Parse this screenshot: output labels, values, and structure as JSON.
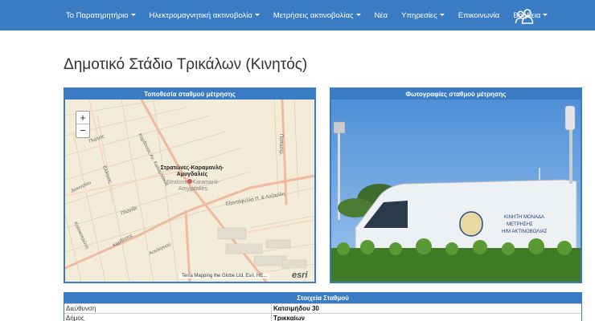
{
  "nav": {
    "items": [
      {
        "label": "Το Παρατηρητήριο",
        "dropdown": true
      },
      {
        "label": "Ηλεκτρομαγνητική ακτινοβολία",
        "dropdown": true
      },
      {
        "label": "Μετρήσεις ακτινοβολίας",
        "dropdown": true
      },
      {
        "label": "Νέα",
        "dropdown": false
      },
      {
        "label": "Υπηρεσίες",
        "dropdown": true
      },
      {
        "label": "Επικοινωνία",
        "dropdown": false
      },
      {
        "label": "Βοήθεια",
        "dropdown": true
      }
    ],
    "users_icon": "users-icon"
  },
  "page": {
    "title": "Δημοτικό Στάδιο Τρικάλων (Κινητός)"
  },
  "map_panel": {
    "heading": "Τοποθεσία σταθμού μέτρησης",
    "zoom_in": "+",
    "zoom_out": "−",
    "station_label": "Στρατώνες-Καραμανλή-Αμυγδαλιές",
    "station_label_en": "Stratones-Karamanli-Amygdalies",
    "attribution": "Terra Mapping the Globe Ltd, Esri, HE...",
    "logo": "esri",
    "streets": [
      "Πυργος",
      "Ελληνος",
      "Διονυσίου",
      "Κολοκοτρώνη",
      "Καρδίτσης",
      "Ασκληπιού",
      "Παπαστρ.",
      "Καρδίτσας Αν. Καλαμπάκας",
      "Εξαντάφυλλα Π. & Λαζαρίδη",
      "Πλαγιζα"
    ]
  },
  "photo_panel": {
    "heading": "Φωτογραφίες σταθμού μέτρησης",
    "van_text": [
      "ΚΙΝΗΤΗ ΜΟΝΑΔΑ",
      "ΜΕΤΡΗΣΗΣ",
      "Η/Μ ΑΚΤΙΝΟΒΟΛΙΑΣ"
    ]
  },
  "station_info": {
    "heading": "Στοιχεία Σταθμού",
    "rows": [
      {
        "key": "Διεύθυνση",
        "value": "Κατσιμήδου 30"
      },
      {
        "key": "Δήμος",
        "value": "Τρικκαίων"
      }
    ]
  }
}
